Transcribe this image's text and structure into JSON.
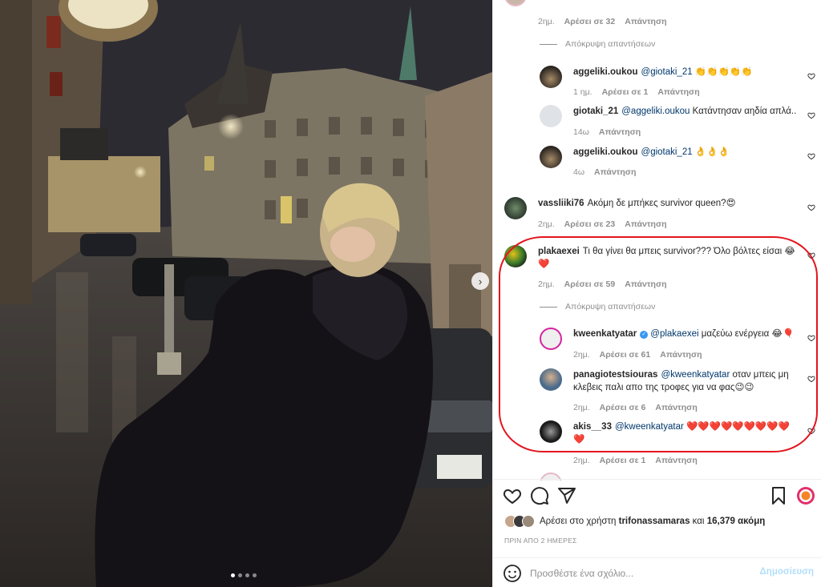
{
  "post": {
    "carousel": {
      "dots": 4,
      "active": 1
    }
  },
  "comments": {
    "top_meta": {
      "time": "2ημ.",
      "likes": "Αρέσει σε 32",
      "reply": "Απάντηση"
    },
    "hide_replies_label": "Απόκρυψη απαντήσεων",
    "items": [
      {
        "user": "aggeliki.oukou",
        "mention": "@giotaki_21",
        "text": "👏👏👏👏👏",
        "time": "1 ημ.",
        "likes": "Αρέσει σε 1",
        "reply": "Απάντηση"
      },
      {
        "user": "giotaki_21",
        "mention": "@aggeliki.oukou",
        "text": "Κατάντησαν αηδία απλά..",
        "time": "14ω",
        "likes": "",
        "reply": "Απάντηση"
      },
      {
        "user": "aggeliki.oukou",
        "mention": "@giotaki_21",
        "text": "👌👌👌",
        "time": "4ω",
        "likes": "",
        "reply": "Απάντηση"
      },
      {
        "user": "vassliiki76",
        "mention": "",
        "text": "Ακόμη δε μπήκες survivor queen?😍",
        "time": "2ημ.",
        "likes": "Αρέσει σε 23",
        "reply": "Απάντηση"
      },
      {
        "user": "plakaexei",
        "mention": "",
        "text": "Τι θα γίνει θα μπεις survivor??? Όλο βόλτες είσαι 😂",
        "text2": "❤️",
        "time": "2ημ.",
        "likes": "Αρέσει σε 59",
        "reply": "Απάντηση"
      },
      {
        "user": "kweenkatyatar",
        "mention": "@plakaexei",
        "text": "μαζεύω ενέργεια 😂🎈",
        "time": "2ημ.",
        "likes": "Αρέσει σε 61",
        "reply": "Απάντηση"
      },
      {
        "user": "panagiotestsiouras",
        "mention": "@kweenkatyatar",
        "text": "οταν μπεις μη",
        "text2": "κλεβεις παλι απο της τροφες για να φας😉😉",
        "time": "2ημ.",
        "likes": "Αρέσει σε 6",
        "reply": "Απάντηση"
      },
      {
        "user": "akis__33",
        "mention": "@kweenkatyatar",
        "text": "❤️❤️❤️❤️❤️❤️❤️❤️❤️",
        "text2": "❤️",
        "time": "2ημ.",
        "likes": "Αρέσει σε 1",
        "reply": "Απάντηση"
      }
    ]
  },
  "likes_bar": {
    "prefix": "Αρέσει στο χρήστη",
    "user": "trifonassamaras",
    "connector": "και",
    "count": "16,379 ακόμη"
  },
  "date_label": "ΠΡΙΝ ΑΠΟ 2 ΗΜΕΡΕΣ",
  "add_comment": {
    "placeholder": "Προσθέστε ένα σχόλιο...",
    "post_label": "Δημοσίευση"
  },
  "icons": [
    "like-icon",
    "comment-icon",
    "share-icon",
    "save-icon",
    "emoji-icon",
    "heart-icon",
    "verified-icon"
  ],
  "colors": {
    "annotation": "#e2151e",
    "mention": "#00376b",
    "muted": "#8e8e8e",
    "post_disabled": "#b2dffc",
    "heart": "#ed4956"
  }
}
